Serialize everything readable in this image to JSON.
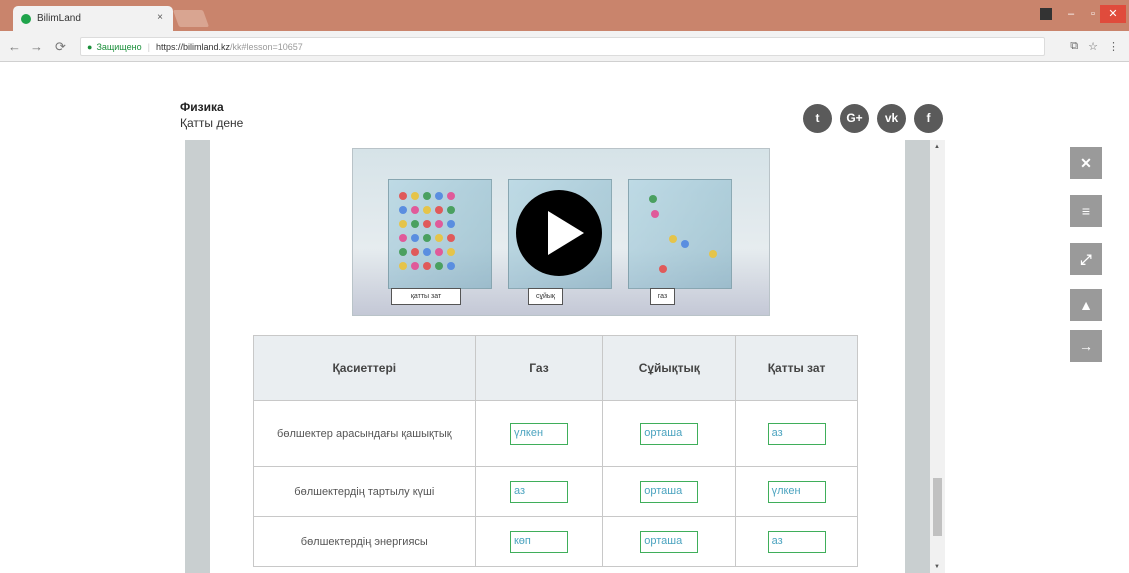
{
  "browser": {
    "tab_title": "BilimLand",
    "tab_close": "×",
    "secure_label": "Защищено",
    "url_host": "https://bilimland.kz",
    "url_path": "/kk#lesson=10657"
  },
  "lesson": {
    "subject": "Физика",
    "topic": "Қатты дене"
  },
  "social": [
    {
      "icon": "twitter-icon",
      "glyph": "t"
    },
    {
      "icon": "google-plus-icon",
      "glyph": "G+"
    },
    {
      "icon": "vk-icon",
      "glyph": "vk"
    },
    {
      "icon": "facebook-icon",
      "glyph": "f"
    }
  ],
  "video": {
    "labels": [
      "қатты зат",
      "сұйық",
      "газ"
    ]
  },
  "table": {
    "headers": [
      "Қасиеттері",
      "Газ",
      "Сұйықтық",
      "Қатты зат"
    ],
    "rows": [
      {
        "property": "бөлшектер арасындағы қашықтық",
        "gas": "үлкен",
        "liquid": "орташа",
        "solid": "аз"
      },
      {
        "property": "бөлшектердің тартылу күші",
        "gas": "аз",
        "liquid": "орташа",
        "solid": "үлкен"
      },
      {
        "property": "бөлшектердің энергиясы",
        "gas": "көп",
        "liquid": "орташа",
        "solid": "аз"
      }
    ]
  },
  "tools": [
    {
      "icon": "close-icon",
      "glyph": "✕"
    },
    {
      "icon": "menu-icon",
      "glyph": "≡"
    },
    {
      "icon": "fullscreen-icon",
      "glyph": "⤢"
    },
    {
      "icon": "warning-icon",
      "glyph": "▲"
    },
    {
      "icon": "arrow-right-icon",
      "glyph": "→"
    }
  ],
  "colors": {
    "chrome": "#c9846c",
    "answer_border": "#3fae5a",
    "answer_text": "#4aa3bf",
    "tool_button": "#9a9a9a"
  }
}
